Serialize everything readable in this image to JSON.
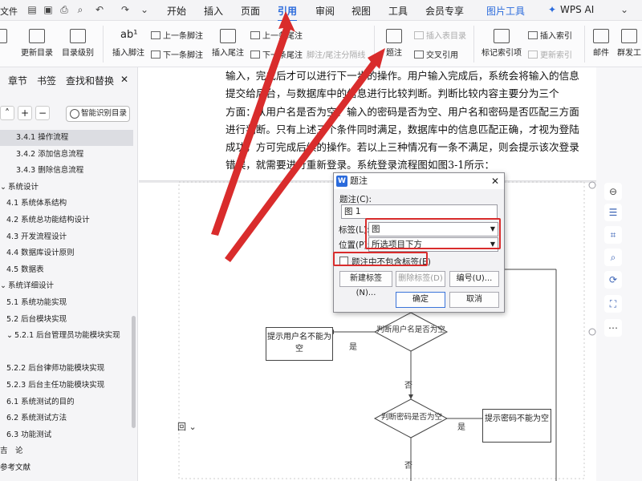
{
  "tabbar": {
    "file_label": "文件",
    "tabs": [
      "开始",
      "插入",
      "页面",
      "引用",
      "审阅",
      "视图",
      "工具",
      "会员专享",
      "图片工具"
    ],
    "active_tab": "引用",
    "ai_label": "WPS AI"
  },
  "ribbon": {
    "update_toc": "更新目录",
    "toc_level": "目录级别",
    "insert_footnote": "插入脚注",
    "prev_footnote": "上一条脚注",
    "next_footnote": "下一条脚注",
    "insert_endnote": "插入尾注",
    "prev_endnote": "上一条尾注",
    "next_endnote": "下一条尾注",
    "note_separator": "脚注/尾注分隔线",
    "caption": "题注",
    "insert_table_of_figures": "插入表目录",
    "cross_reference": "交叉引用",
    "mark_index": "标记索引项",
    "insert_index": "插入索引",
    "update_index": "更新索引",
    "mail": "邮件",
    "group_send": "群发工"
  },
  "sidebar": {
    "tabs": [
      "章节",
      "书签",
      "查找和替换"
    ],
    "smart_toc": "智能识别目录",
    "toc": [
      {
        "label": "3.4.1 操作流程",
        "indent": 3,
        "selected": true
      },
      {
        "label": "3.4.2 添加信息流程",
        "indent": 3
      },
      {
        "label": "3.4.3 删除信息流程",
        "indent": 3
      },
      {
        "label": "系统设计",
        "indent": 0,
        "caret": "⌄"
      },
      {
        "label": "4.1 系统体系结构",
        "indent": 1
      },
      {
        "label": "4.2 系统总功能结构设计",
        "indent": 1
      },
      {
        "label": "4.3 开发流程设计",
        "indent": 1
      },
      {
        "label": "4.4 数据库设计原则",
        "indent": 1
      },
      {
        "label": "4.5 数据表",
        "indent": 1
      },
      {
        "label": "系统详细设计",
        "indent": 0,
        "caret": "⌄"
      },
      {
        "label": "5.1 系统功能实现",
        "indent": 1
      },
      {
        "label": "5.2 后台模块实现",
        "indent": 1
      },
      {
        "label": "5.2.1 后台管理员功能模块实现",
        "indent": 1,
        "caret": "⌄"
      },
      {
        "label": "",
        "indent": 1
      },
      {
        "label": "5.2.2 后台律师功能模块实现",
        "indent": 1
      },
      {
        "label": "5.2.3 后台主任功能模块实现",
        "indent": 1
      },
      {
        "label": "6.1 系统测试的目的",
        "indent": 1
      },
      {
        "label": "6.2 系统测试方法",
        "indent": 1
      },
      {
        "label": "6.3 功能测试",
        "indent": 1
      },
      {
        "label": "吉　论",
        "indent": 0
      },
      {
        "label": "参考文献",
        "indent": 0
      }
    ]
  },
  "document": {
    "lines": [
      "输入，完成后才可以进行下一步的操作。用户输入完成后，系统会将输入的信息",
      "提交给后台，与数据库中的信息进行比较判断。判断比较内容主要分为三个",
      "方面：从用户名是否为空、输入的密码是否为空、用户名和密码是否匹配三方面",
      "进行判断。只有上述三个条件同时满足，数据库中的信息匹配正确，才视为登陆",
      "成功，方可完成后续的操作。若以上三种情况有一条不满足，则会提示该次登录",
      "错误，就需要进行重新登录。系统登录流程图如图3-1所示："
    ],
    "flow": {
      "box_empty_user": "提示用户名不能为空",
      "diamond_user": "判断用户名是否为空",
      "diamond_pwd": "判断密码是否为空",
      "box_empty_pwd": "提示密码不能为空",
      "yes": "是",
      "no": "否"
    }
  },
  "dialog": {
    "title": "题注",
    "caption_label": "题注(C):",
    "caption_value": "图 1",
    "label_label": "标签(L):",
    "label_value": "图",
    "position_label": "位置(P):",
    "position_value": "所选项目下方",
    "exclude_label": "题注中不包含标签(E)",
    "new_label_btn": "新建标签(N)...",
    "delete_label_btn": "删除标签(D)",
    "numbering_btn": "编号(U)...",
    "ok_btn": "确定",
    "cancel_btn": "取消"
  },
  "colors": {
    "accent": "#2b6bdc",
    "arrow_red": "#d92c2c"
  }
}
